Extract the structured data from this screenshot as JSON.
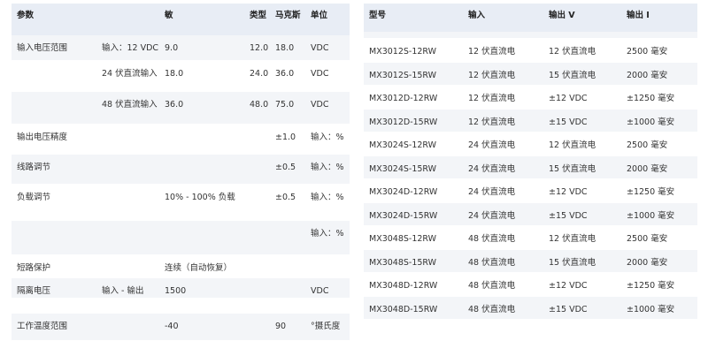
{
  "left_table": {
    "headers": [
      "参数",
      "",
      "敏",
      "类型",
      "马克斯",
      "单位"
    ],
    "rows": [
      [
        "输入电压范围",
        "输入：12 VDC",
        "9.0",
        "12.0",
        "18.0",
        "VDC"
      ],
      [
        "",
        "24 伏直流输入",
        "18.0",
        "24.0",
        "36.0",
        "VDC"
      ],
      [
        "",
        "48 伏直流输入",
        "36.0",
        "48.0",
        "75.0",
        "VDC"
      ],
      [
        "输出电压精度",
        "",
        "",
        "",
        "±1.0",
        "输入：%"
      ],
      [
        "线路调节",
        "",
        "",
        "",
        "±0.5",
        "输入：%"
      ],
      [
        "负载调节",
        "",
        "10% - 100% 负载",
        "",
        "±0.5",
        "输入：%"
      ],
      [
        "",
        "",
        "",
        "",
        "",
        "输入：%"
      ],
      [
        "短路保护",
        "",
        "连续（自动恢复）",
        "",
        "",
        ""
      ],
      [
        "隔离电压",
        "输入 - 输出",
        "1500",
        "",
        "",
        "VDC"
      ],
      [
        "",
        "",
        "",
        "",
        "",
        ""
      ],
      [
        "工作温度范围",
        "",
        "-40",
        "",
        "90",
        "°摄氏度"
      ]
    ]
  },
  "right_table": {
    "headers": [
      "型号",
      "输入",
      "输出 V",
      "输出 I"
    ],
    "rows": [
      [
        "",
        "",
        "",
        ""
      ],
      [
        "MX3012S-12RW",
        "12 伏直流电",
        "12 伏直流电",
        "2500 毫安"
      ],
      [
        "MX3012S-15RW",
        "12 伏直流电",
        "15 伏直流电",
        "2000 毫安"
      ],
      [
        "MX3012D-12RW",
        "12 伏直流电",
        "±12 VDC",
        "±1250 毫安"
      ],
      [
        "MX3012D-15RW",
        "12 伏直流电",
        "±15 VDC",
        "±1000 毫安"
      ],
      [
        "MX3024S-12RW",
        "24 伏直流电",
        "12 伏直流电",
        "2500 毫安"
      ],
      [
        "MX3024S-15RW",
        "24 伏直流电",
        "15 伏直流电",
        "2000 毫安"
      ],
      [
        "MX3024D-12RW",
        "24 伏直流电",
        "±12 VDC",
        "±1250 毫安"
      ],
      [
        "MX3024D-15RW",
        "24 伏直流电",
        "±15 VDC",
        "±1000 毫安"
      ],
      [
        "MX3048S-12RW",
        "48 伏直流电",
        "12 伏直流电",
        "2500 毫安"
      ],
      [
        "MX3048S-15RW",
        "48 伏直流电",
        "15 伏直流电",
        "2000 毫安"
      ],
      [
        "MX3048D-12RW",
        "48 伏直流电",
        "±12 VDC",
        "±1250 毫安"
      ],
      [
        "MX3048D-15RW",
        "48 伏直流电",
        "±15 VDC",
        "±1000 毫安"
      ]
    ]
  }
}
